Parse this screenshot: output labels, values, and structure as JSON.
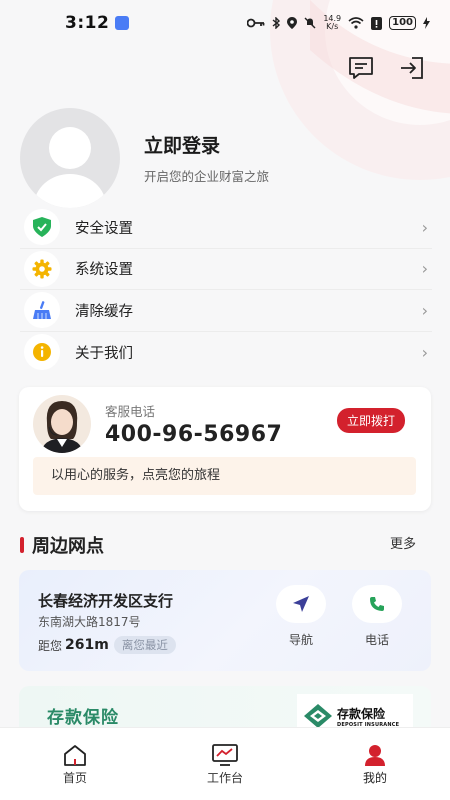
{
  "status_bar": {
    "time": "3:12",
    "net_speed_top": "14.9",
    "net_speed_bottom": "K/s",
    "battery": "100"
  },
  "profile": {
    "login_label": "立即登录",
    "subtitle": "开启您的企业财富之旅"
  },
  "menu": [
    {
      "label": "安全设置",
      "icon": "shield-icon",
      "color": "#27b35a"
    },
    {
      "label": "系统设置",
      "icon": "gear-icon",
      "color": "#f4b400"
    },
    {
      "label": "清除缓存",
      "icon": "broom-icon",
      "color": "#4a7cf5"
    },
    {
      "label": "关于我们",
      "icon": "info-icon",
      "color": "#f4b400"
    }
  ],
  "service": {
    "label": "客服电话",
    "phone": "400-96-56967",
    "call_button": "立即拨打",
    "slogan": "以用心的服务，点亮您的旅程"
  },
  "nearby": {
    "title": "周边网点",
    "more": "更多",
    "branch": {
      "name": "长春经济开发区支行",
      "address": "东南湖大路1817号",
      "distance_prefix": "距您",
      "distance": "261m",
      "tag": "离您最近",
      "nav_label": "导航",
      "call_label": "电话"
    }
  },
  "deposit": {
    "title": "存款保险",
    "logo_title": "存款保险",
    "logo_sub": "DEPOSIT INSURANCE"
  },
  "tabs": [
    {
      "label": "首页",
      "icon": "home-icon"
    },
    {
      "label": "工作台",
      "icon": "monitor-icon"
    },
    {
      "label": "我的",
      "icon": "user-icon",
      "active": true
    }
  ],
  "colors": {
    "brand_red": "#d3212d",
    "deposit_green": "#2a8a67"
  }
}
